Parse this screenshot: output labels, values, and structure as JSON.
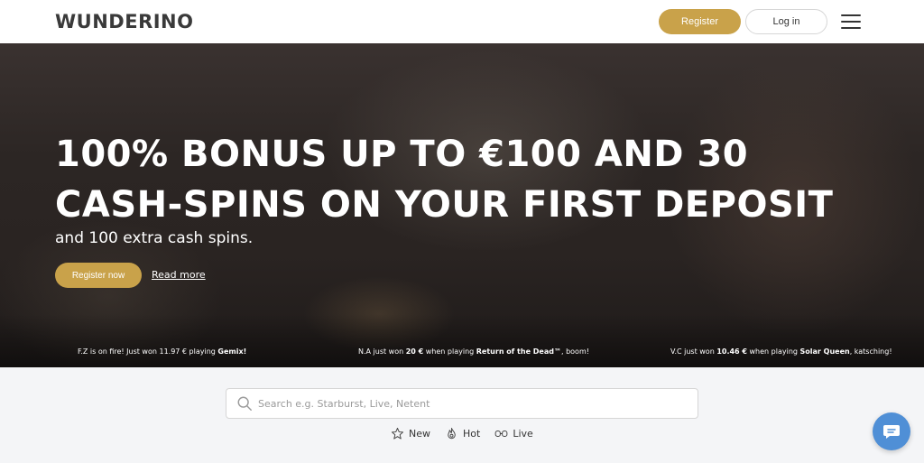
{
  "header": {
    "logo": "WUNDERINO",
    "register_label": "Register",
    "login_label": "Log in",
    "menu_icon": "hamburger-menu-icon"
  },
  "hero": {
    "title": "100% BONUS UP TO €100 AND 30 CASH-SPINS ON YOUR FIRST DEPOSIT",
    "subtitle": "and 100 extra cash spins.",
    "register_now_label": "Register now",
    "read_more_label": "Read more"
  },
  "ticker": [
    {
      "prefix": "F.Z is on fire! Just won 11.97 € playing ",
      "game": "Gemix!",
      "suffix": ""
    },
    {
      "prefix": "N.A just won ",
      "amount": "20 €",
      "middle": " when playing ",
      "game": "Return of the Dead™",
      "suffix": ", boom!"
    },
    {
      "prefix": "V.C just won ",
      "amount": "10.46 €",
      "middle": " when playing ",
      "game": "Solar Queen",
      "suffix": ", katsching!"
    }
  ],
  "search": {
    "placeholder": "Search e.g. Starburst, Live, Netent",
    "icon": "search-icon"
  },
  "filters": [
    {
      "label": "New",
      "icon": "star-icon"
    },
    {
      "label": "Hot",
      "icon": "flame-icon"
    },
    {
      "label": "Live",
      "icon": "live-icon"
    }
  ],
  "chat": {
    "icon": "chat-icon"
  },
  "colors": {
    "accent": "#c9a24a",
    "chat": "#4f8fd6",
    "background": "#f4f5f7"
  }
}
